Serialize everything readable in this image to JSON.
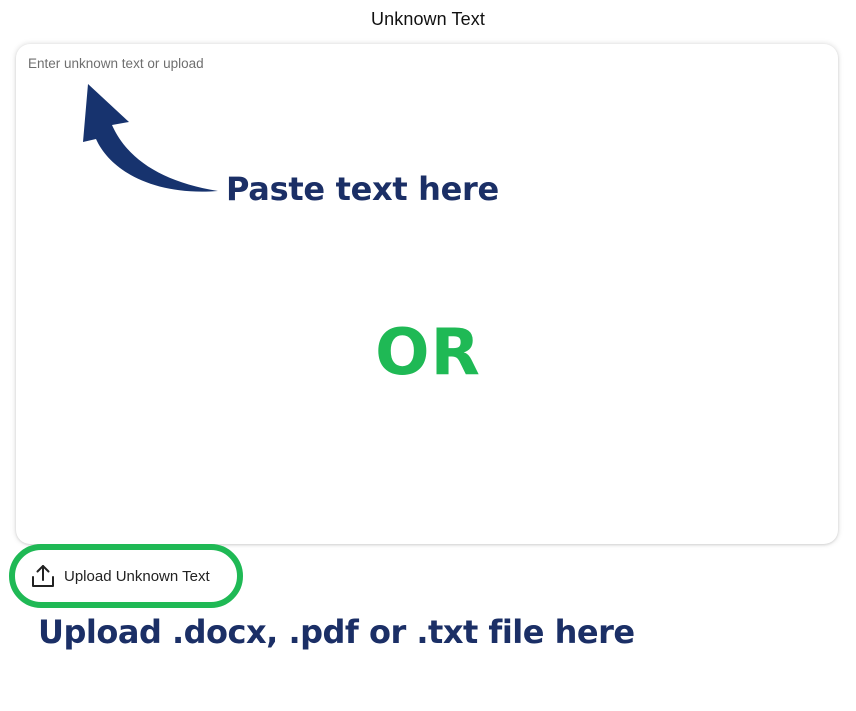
{
  "header": {
    "title": "Unknown Text"
  },
  "text_area": {
    "placeholder": "Enter unknown text or upload",
    "value": ""
  },
  "annotations": {
    "paste_label": "Paste text here",
    "or_label": "OR",
    "upload_hint": "Upload .docx, .pdf or .txt file here",
    "arrow_icon": "curved-arrow-icon"
  },
  "upload": {
    "label": "Upload Unknown Text",
    "icon": "upload-icon"
  },
  "colors": {
    "navy": "#1b2f66",
    "green": "#1fb955"
  }
}
